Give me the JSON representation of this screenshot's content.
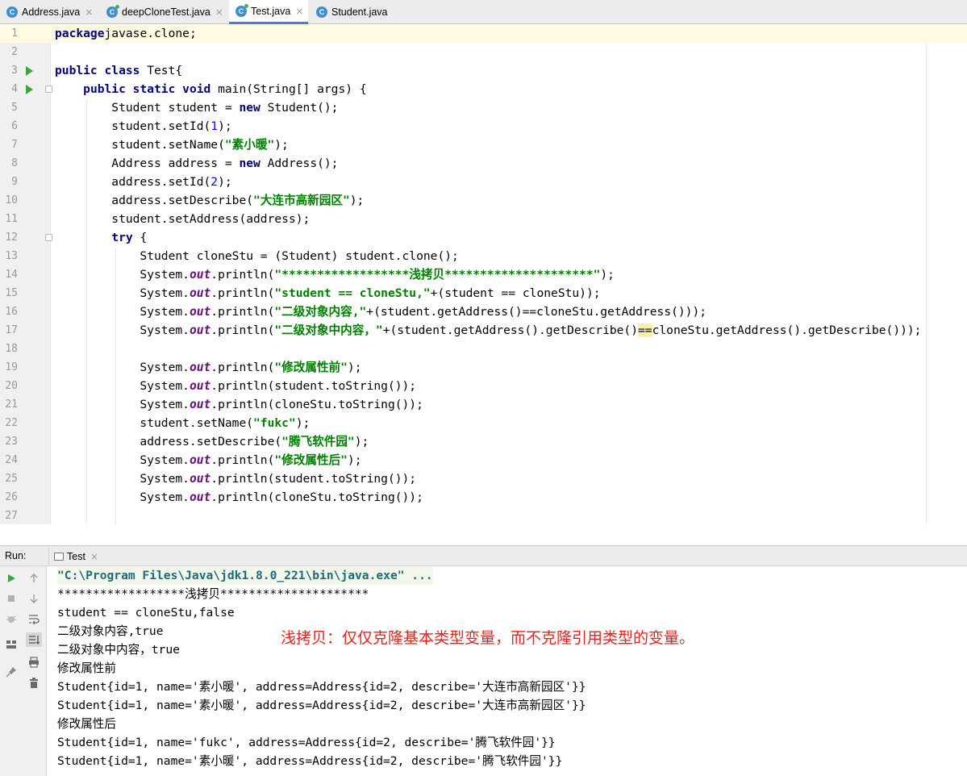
{
  "tabs": [
    {
      "label": "Address.java",
      "icon": "java-class-icon",
      "close": "×"
    },
    {
      "label": "deepCloneTest.java",
      "icon": "java-class-icon",
      "close": "×"
    },
    {
      "label": "Test.java",
      "icon": "java-class-icon",
      "close": "×",
      "active": true
    },
    {
      "label": "Student.java",
      "icon": "java-class-icon",
      "close": ""
    }
  ],
  "editor": {
    "line_numbers": [
      "1",
      "2",
      "3",
      "4",
      "5",
      "6",
      "7",
      "8",
      "9",
      "10",
      "11",
      "12",
      "13",
      "14",
      "15",
      "16",
      "17",
      "18",
      "19",
      "20",
      "21",
      "22",
      "23",
      "24",
      "25",
      "26",
      "27"
    ],
    "lines": [
      [
        [
          "kw",
          "package"
        ],
        [
          "",
          "javase.clone;"
        ]
      ],
      [],
      [
        [
          "kw",
          "public class "
        ],
        [
          "",
          "Test{"
        ]
      ],
      [
        [
          "",
          "    "
        ],
        [
          "kw",
          "public static void "
        ],
        [
          "",
          "main(String[] args) {"
        ]
      ],
      [
        [
          "",
          "        Student student = "
        ],
        [
          "kw",
          "new "
        ],
        [
          "",
          "Student();"
        ]
      ],
      [
        [
          "",
          "        student.setId("
        ],
        [
          "nm",
          "1"
        ],
        [
          "",
          "); "
        ]
      ],
      [
        [
          "",
          "        student.setName("
        ],
        [
          "st",
          "\"素小暖\""
        ],
        [
          "",
          ");"
        ]
      ],
      [
        [
          "",
          "        Address address = "
        ],
        [
          "kw",
          "new "
        ],
        [
          "",
          "Address();"
        ]
      ],
      [
        [
          "",
          "        address.setId("
        ],
        [
          "nm",
          "2"
        ],
        [
          "",
          ");"
        ]
      ],
      [
        [
          "",
          "        address.setDescribe("
        ],
        [
          "st",
          "\"大连市高新园区\""
        ],
        [
          "",
          ");"
        ]
      ],
      [
        [
          "",
          "        student.setAddress(address);"
        ]
      ],
      [
        [
          "",
          "        "
        ],
        [
          "kw",
          "try "
        ],
        [
          "",
          "{"
        ]
      ],
      [
        [
          "",
          "            Student cloneStu = (Student) student.clone();"
        ]
      ],
      [
        [
          "",
          "            System."
        ],
        [
          "fld",
          "out"
        ],
        [
          "",
          ".println("
        ],
        [
          "st",
          "\"******************浅拷贝*********************\""
        ],
        [
          "",
          ");"
        ]
      ],
      [
        [
          "",
          "            System."
        ],
        [
          "fld",
          "out"
        ],
        [
          "",
          ".println("
        ],
        [
          "st",
          "\"student == cloneStu,\""
        ],
        [
          "",
          "+(student == cloneStu));"
        ]
      ],
      [
        [
          "",
          "            System."
        ],
        [
          "fld",
          "out"
        ],
        [
          "",
          ".println("
        ],
        [
          "st",
          "\"二级对象内容,\""
        ],
        [
          "",
          "+(student.getAddress()==cloneStu.getAddress()));"
        ]
      ],
      [
        [
          "",
          "            System."
        ],
        [
          "fld",
          "out"
        ],
        [
          "",
          ".println("
        ],
        [
          "st",
          "\"二级对象中内容，\""
        ],
        [
          "",
          "+(student.getAddress().getDescribe()"
        ],
        [
          "hl",
          "=="
        ],
        [
          "",
          "cloneStu.getAddress().getDescribe()));"
        ]
      ],
      [],
      [
        [
          "",
          "            System."
        ],
        [
          "fld",
          "out"
        ],
        [
          "",
          ".println("
        ],
        [
          "st",
          "\"修改属性前\""
        ],
        [
          "",
          ");"
        ]
      ],
      [
        [
          "",
          "            System."
        ],
        [
          "fld",
          "out"
        ],
        [
          "",
          ".println(student.toString());"
        ]
      ],
      [
        [
          "",
          "            System."
        ],
        [
          "fld",
          "out"
        ],
        [
          "",
          ".println(cloneStu.toString());"
        ]
      ],
      [
        [
          "",
          "            student.setName("
        ],
        [
          "st",
          "\"fukc\""
        ],
        [
          "",
          ");"
        ]
      ],
      [
        [
          "",
          "            address.setDescribe("
        ],
        [
          "st",
          "\"腾飞软件园\""
        ],
        [
          "",
          ");"
        ]
      ],
      [
        [
          "",
          "            System."
        ],
        [
          "fld",
          "out"
        ],
        [
          "",
          ".println("
        ],
        [
          "st",
          "\"修改属性后\""
        ],
        [
          "",
          ");"
        ]
      ],
      [
        [
          "",
          "            System."
        ],
        [
          "fld",
          "out"
        ],
        [
          "",
          ".println(student.toString());"
        ]
      ],
      [
        [
          "",
          "            System."
        ],
        [
          "fld",
          "out"
        ],
        [
          "",
          ".println(cloneStu.toString());"
        ]
      ],
      []
    ]
  },
  "run_panel": {
    "label": "Run:",
    "tab_label": "Test",
    "tab_close": "×"
  },
  "console": {
    "lines": [
      "\"C:\\Program Files\\Java\\jdk1.8.0_221\\bin\\java.exe\" ...",
      "******************浅拷贝*********************",
      "student == cloneStu,false",
      "二级对象内容,true",
      "二级对象中内容，true",
      "修改属性前",
      "Student{id=1, name='素小暖', address=Address{id=2, describe='大连市高新园区'}}",
      "Student{id=1, name='素小暖', address=Address{id=2, describe='大连市高新园区'}}",
      "修改属性后",
      "Student{id=1, name='fukc', address=Address{id=2, describe='腾飞软件园'}}",
      "Student{id=1, name='素小暖', address=Address{id=2, describe='腾飞软件园'}}"
    ]
  },
  "annotation": "浅拷贝：仅仅克隆基本类型变量，而不克隆引用类型的变量。",
  "colors": {
    "keyword": "#000080",
    "string": "#008000",
    "number": "#0000ff",
    "field": "#660e7a",
    "annotation": "#e8231c",
    "run_icon": "#3ea53e"
  }
}
